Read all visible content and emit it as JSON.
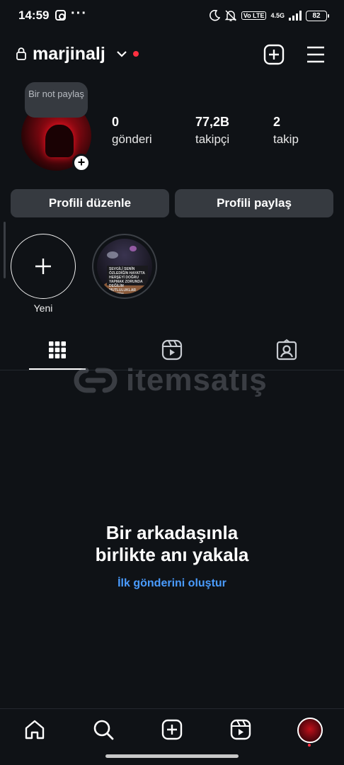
{
  "status_bar": {
    "time": "14:59",
    "dots": "···",
    "lte": "Vo LTE",
    "network": "4.5G",
    "battery": "82",
    "icons": [
      "instagram-icon",
      "moon-icon",
      "bell-off-icon",
      "signal-icon",
      "battery-icon"
    ]
  },
  "header": {
    "username": "marjinalj",
    "icons": [
      "lock-icon",
      "chevron-down-icon",
      "create-icon",
      "menu-icon"
    ],
    "notification_color": "#ff3040"
  },
  "profile": {
    "note": "Bir not paylaş",
    "stats": [
      {
        "value": "0",
        "label": "gönderi"
      },
      {
        "value": "77,2B",
        "label": "takipçi"
      },
      {
        "value": "2",
        "label": "takip"
      }
    ],
    "edit_button": "Profili düzenle",
    "share_button": "Profili paylaş"
  },
  "highlights": {
    "new_label": "Yeni",
    "story_text": "SEVGİLİ SENİN ÖZLEDİĞİN HAYATTA HERŞEYİ DOĞRU YAPMAK ZORUNDA DEĞİLİM MUTLULUKLAR DİLERİM"
  },
  "tabs": [
    "grid-icon",
    "reels-icon",
    "tagged-icon"
  ],
  "watermark": "itemsatış",
  "empty_state": {
    "title_line1": "Bir arkadaşınla",
    "title_line2": "birlikte anı yakala",
    "link": "İlk gönderini oluştur"
  },
  "bottom_nav": [
    "home-icon",
    "search-icon",
    "create-icon",
    "reels-icon",
    "profile-avatar"
  ],
  "colors": {
    "background": "#0f1216",
    "button": "#363a40",
    "link": "#4a9cff",
    "badge": "#ff3040"
  }
}
